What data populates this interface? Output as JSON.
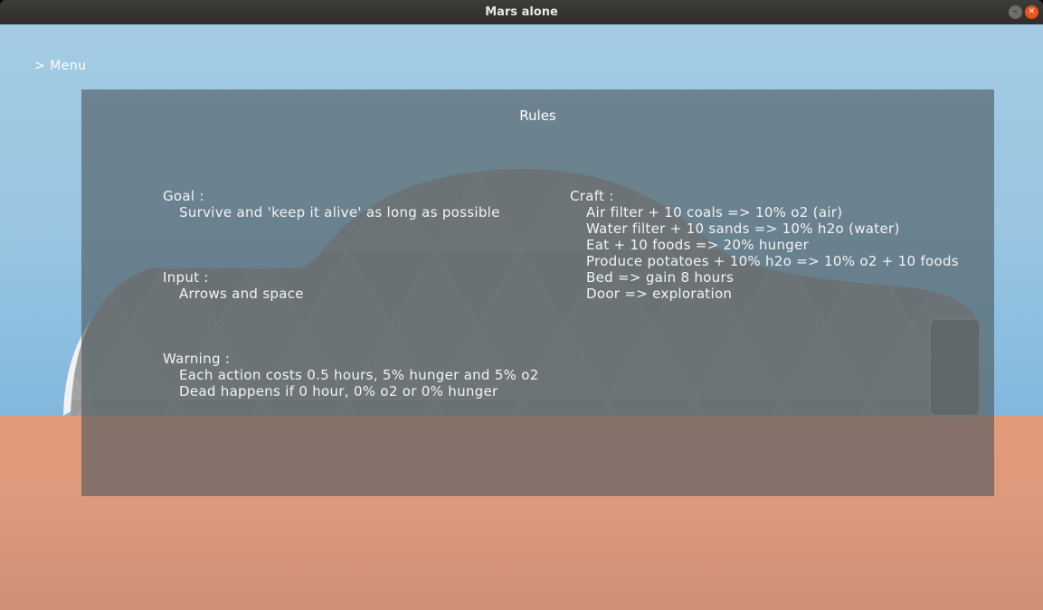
{
  "window": {
    "title": "Mars alone",
    "minimize_glyph": "–",
    "close_glyph": "✕"
  },
  "menu": {
    "label": "> Menu"
  },
  "rules": {
    "title": "Rules",
    "goal": {
      "heading": "Goal :",
      "lines": [
        "Survive and 'keep it alive' as long as possible"
      ]
    },
    "input": {
      "heading": "Input :",
      "lines": [
        "Arrows and space"
      ]
    },
    "warning": {
      "heading": "Warning :",
      "lines": [
        "Each action costs 0.5 hours, 5% hunger and 5% o2",
        "Dead happens if 0 hour, 0% o2 or 0% hunger"
      ]
    },
    "craft": {
      "heading": "Craft :",
      "lines": [
        "Air filter + 10 coals => 10% o2 (air)",
        "Water filter + 10 sands => 10% h2o (water)",
        "Eat + 10 foods => 20% hunger",
        "Produce potatoes + 10% h2o => 10% o2 + 10 foods",
        "Bed => gain 8 hours",
        "Door => exploration"
      ]
    }
  },
  "colors": {
    "sky": "#9ac6e2",
    "ground": "#de9a7c",
    "habitat": "#9e9e9e",
    "door": "#808080",
    "panel": "#505a60",
    "titlebar": "#2f2e2b",
    "close_button": "#e95420"
  }
}
